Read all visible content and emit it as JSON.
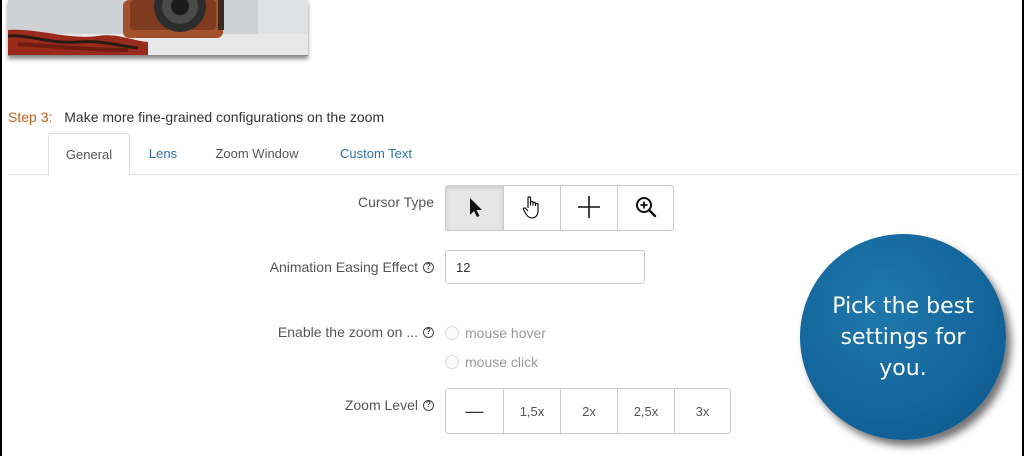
{
  "step": {
    "label": "Step 3:",
    "text": "Make more fine-grained configurations on the zoom"
  },
  "tabs": [
    {
      "label": "General",
      "active": true
    },
    {
      "label": "Lens",
      "active": false
    },
    {
      "label": "Zoom Window",
      "active": false
    },
    {
      "label": "Custom Text",
      "active": false
    }
  ],
  "cursor_type": {
    "label": "Cursor Type",
    "options": [
      {
        "icon": "arrow-pointer-icon",
        "selected": true
      },
      {
        "icon": "hand-pointer-icon",
        "selected": false
      },
      {
        "icon": "crosshair-icon",
        "selected": false
      },
      {
        "icon": "zoom-in-icon",
        "selected": false
      }
    ]
  },
  "easing": {
    "label": "Animation Easing Effect",
    "value": "12"
  },
  "enable_zoom": {
    "label": "Enable the zoom on ...",
    "options": [
      "mouse hover",
      "mouse click"
    ]
  },
  "zoom_level": {
    "label": "Zoom Level",
    "options": [
      "—",
      "1,5x",
      "2x",
      "2,5x",
      "3x"
    ]
  },
  "help_glyph": "?",
  "callout": {
    "text": "Pick the best settings for you."
  },
  "colors": {
    "step_label": "#c0621b",
    "tab_link": "#2f6fa5",
    "callout": "#13649a"
  }
}
